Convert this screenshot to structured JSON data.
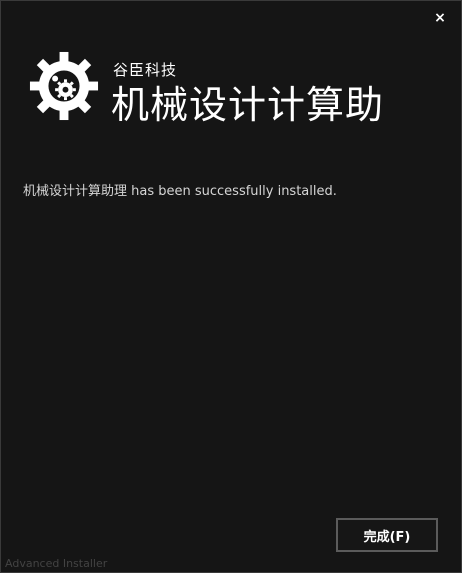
{
  "window": {
    "close_glyph": "×"
  },
  "brand": {
    "company": "谷臣科技",
    "product": "机械设计计算助",
    "logo_icon": "gear-icon"
  },
  "main": {
    "message": "机械设计计算助理 has been successfully installed."
  },
  "actions": {
    "finish_label": "完成(F)"
  },
  "footer": {
    "installer_label": "Advanced Installer"
  },
  "colors": {
    "background": "#151515",
    "text": "#ffffff",
    "message_text": "#d5d5d5",
    "button_border": "#5b5b5b",
    "footer_text": "#434343"
  }
}
